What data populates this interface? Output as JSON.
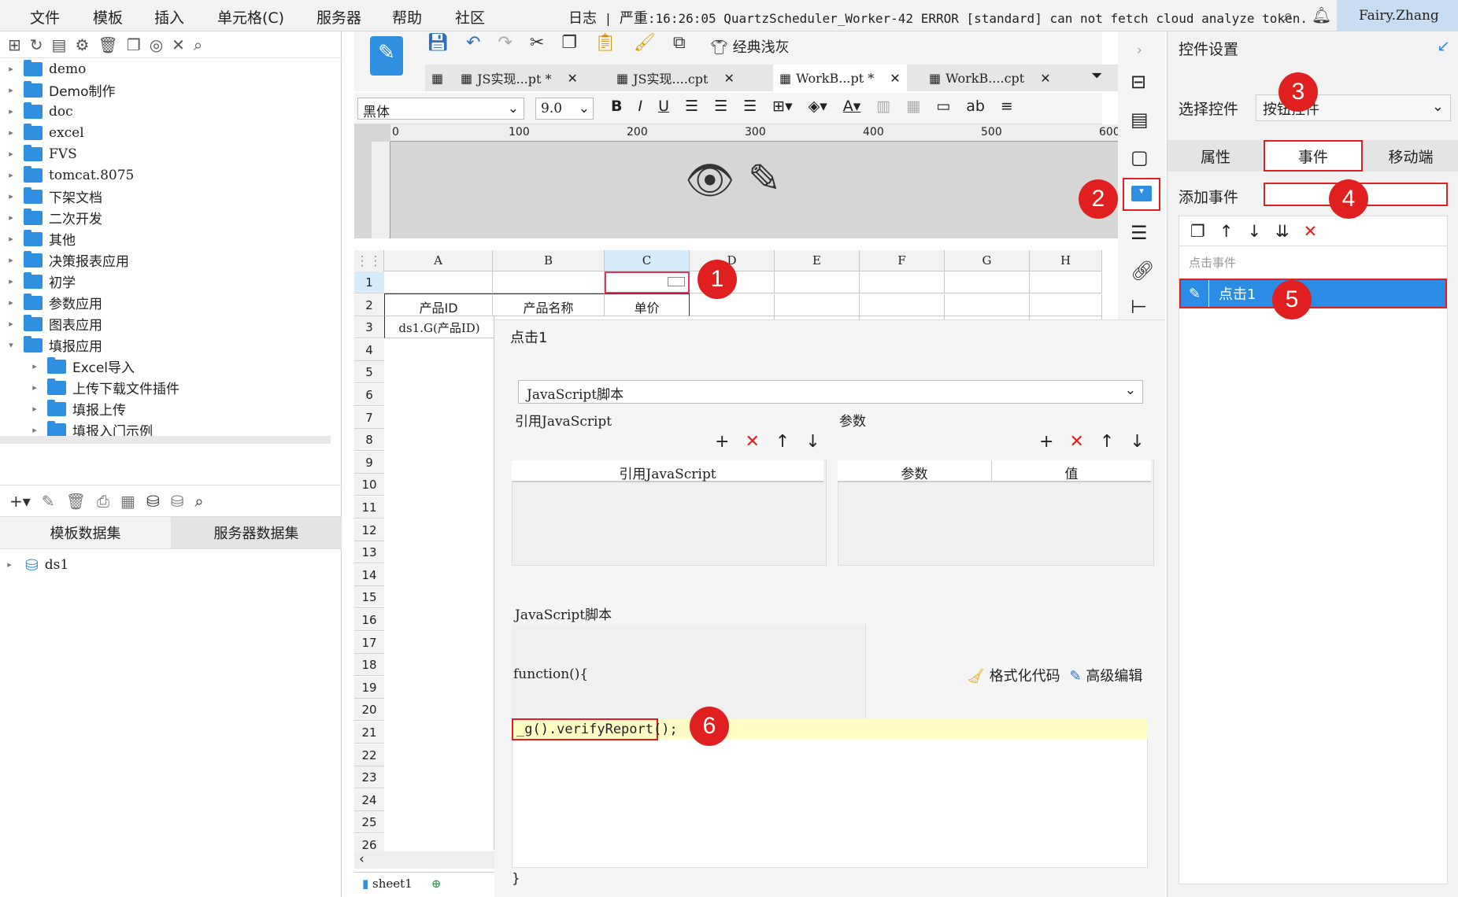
{
  "menu": [
    "文件",
    "模板",
    "插入",
    "单元格(C)",
    "服务器",
    "帮助",
    "社区"
  ],
  "log": {
    "prefix": "日志",
    "level": "严重",
    "text": "16:26:05 QuartzScheduler_Worker-42 ERROR [standard] can not fetch cloud analyze token."
  },
  "user": "Fairy.Zhang",
  "tree": [
    {
      "label": "demo",
      "level": 0
    },
    {
      "label": "Demo制作",
      "level": 0
    },
    {
      "label": "doc",
      "level": 0
    },
    {
      "label": "excel",
      "level": 0
    },
    {
      "label": "FVS",
      "level": 0
    },
    {
      "label": "tomcat.8075",
      "level": 0
    },
    {
      "label": "下架文档",
      "level": 0
    },
    {
      "label": "二次开发",
      "level": 0
    },
    {
      "label": "其他",
      "level": 0
    },
    {
      "label": "决策报表应用",
      "level": 0
    },
    {
      "label": "初学",
      "level": 0
    },
    {
      "label": "参数应用",
      "level": 0
    },
    {
      "label": "图表应用",
      "level": 0
    },
    {
      "label": "填报应用",
      "level": 0,
      "expanded": true
    },
    {
      "label": "Excel导入",
      "level": 1
    },
    {
      "label": "上传下载文件插件",
      "level": 1
    },
    {
      "label": "填报上传",
      "level": 1
    },
    {
      "label": "填报入门示例",
      "level": 1
    }
  ],
  "dataset_tabs": [
    "模板数据集",
    "服务器数据集"
  ],
  "datasets": [
    "ds1"
  ],
  "toolbar": {
    "theme_label": "经典浅灰"
  },
  "file_tabs": [
    "JS实现...pt *",
    "JS实现....cpt",
    "WorkB...pt *",
    "WorkB....cpt"
  ],
  "format": {
    "font": "黑体",
    "size": "9.0"
  },
  "ruler": [
    "0",
    "100",
    "200",
    "300",
    "400",
    "500",
    "600"
  ],
  "columns": [
    "A",
    "B",
    "C",
    "D",
    "E",
    "F",
    "G",
    "H"
  ],
  "rows": [
    "1",
    "2",
    "3",
    "4",
    "5",
    "6",
    "7",
    "8",
    "9",
    "10",
    "11",
    "12",
    "13",
    "14",
    "15",
    "16",
    "17",
    "18",
    "19",
    "20",
    "21",
    "22",
    "23",
    "24",
    "25",
    "26"
  ],
  "cells": {
    "a2": "产品ID",
    "b2": "产品名称",
    "c2": "单价",
    "a3": "ds1.G(产品ID)"
  },
  "sheet_tab": "sheet1",
  "dialog": {
    "title": "点击1",
    "type": "JavaScript脚本",
    "ref_js_label": "引用JavaScript",
    "params_label": "参数",
    "ref_js_header": "引用JavaScript",
    "param_col": "参数",
    "value_col": "值",
    "script_label": "JavaScript脚本",
    "fn_open": "function(){",
    "code": "_g().verifyReport();",
    "fn_close": "}",
    "format_code": "格式化代码",
    "advanced_edit": "高级编辑"
  },
  "right": {
    "title": "控件设置",
    "select_label": "选择控件",
    "select_value": "按钮控件",
    "tabs": [
      "属性",
      "事件",
      "移动端"
    ],
    "add_event": "添加事件",
    "event_group": "点击事件",
    "event_item": "点击1"
  },
  "badges": [
    "1",
    "2",
    "3",
    "4",
    "5",
    "6"
  ],
  "colors": {
    "accent": "#2f8fe0",
    "badge": "#e02020",
    "selected": "#2b8ce6",
    "highlight": "#fffbc4"
  }
}
